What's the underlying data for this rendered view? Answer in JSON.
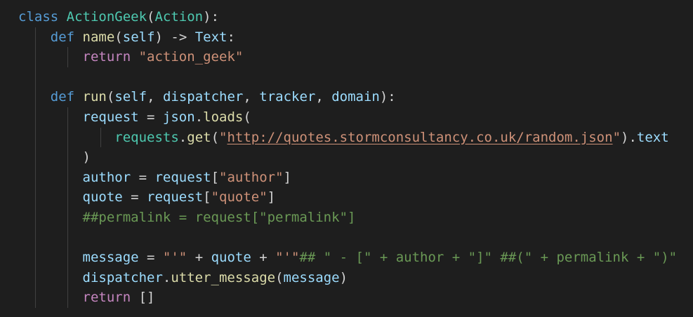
{
  "editor": {
    "colors": {
      "background": "#1e1e1e",
      "keyword": "#569cd6",
      "control": "#c586c0",
      "class": "#4ec9b0",
      "function": "#dcdcaa",
      "variable": "#9cdcfe",
      "string": "#ce9178",
      "comment": "#6a9955",
      "plain": "#d4d4d4"
    },
    "lines": [
      {
        "indent": 0,
        "tokens": [
          {
            "t": "keyword",
            "v": "class "
          },
          {
            "t": "class",
            "v": "ActionGeek"
          },
          {
            "t": "plain",
            "v": "("
          },
          {
            "t": "class",
            "v": "Action"
          },
          {
            "t": "plain",
            "v": "):"
          }
        ]
      },
      {
        "indent": 1,
        "tokens": [
          {
            "t": "keyword",
            "v": "def "
          },
          {
            "t": "function",
            "v": "name"
          },
          {
            "t": "plain",
            "v": "("
          },
          {
            "t": "param",
            "v": "self"
          },
          {
            "t": "plain",
            "v": ") -> "
          },
          {
            "t": "variable",
            "v": "Text"
          },
          {
            "t": "plain",
            "v": ":"
          }
        ]
      },
      {
        "indent": 2,
        "tokens": [
          {
            "t": "control",
            "v": "return "
          },
          {
            "t": "string",
            "v": "\"action_geek\""
          }
        ]
      },
      {
        "indent": 0,
        "tokens": []
      },
      {
        "indent": 1,
        "tokens": [
          {
            "t": "keyword",
            "v": "def "
          },
          {
            "t": "function",
            "v": "run"
          },
          {
            "t": "plain",
            "v": "("
          },
          {
            "t": "param",
            "v": "self"
          },
          {
            "t": "plain",
            "v": ", "
          },
          {
            "t": "param",
            "v": "dispatcher"
          },
          {
            "t": "plain",
            "v": ", "
          },
          {
            "t": "param",
            "v": "tracker"
          },
          {
            "t": "plain",
            "v": ", "
          },
          {
            "t": "param",
            "v": "domain"
          },
          {
            "t": "plain",
            "v": "):"
          }
        ]
      },
      {
        "indent": 2,
        "tokens": [
          {
            "t": "variable",
            "v": "request"
          },
          {
            "t": "plain",
            "v": " = "
          },
          {
            "t": "variable",
            "v": "json"
          },
          {
            "t": "plain",
            "v": "."
          },
          {
            "t": "function",
            "v": "loads"
          },
          {
            "t": "plain",
            "v": "("
          }
        ]
      },
      {
        "indent": 3,
        "tokens": [
          {
            "t": "class",
            "v": "requests"
          },
          {
            "t": "plain",
            "v": "."
          },
          {
            "t": "function",
            "v": "get"
          },
          {
            "t": "plain",
            "v": "("
          },
          {
            "t": "string",
            "v": "\""
          },
          {
            "t": "link",
            "v": "http://quotes.stormconsultancy.co.uk/random.json"
          },
          {
            "t": "string",
            "v": "\""
          },
          {
            "t": "plain",
            "v": ")."
          },
          {
            "t": "variable",
            "v": "text"
          }
        ]
      },
      {
        "indent": 2,
        "tokens": [
          {
            "t": "plain",
            "v": ")"
          }
        ]
      },
      {
        "indent": 2,
        "tokens": [
          {
            "t": "variable",
            "v": "author"
          },
          {
            "t": "plain",
            "v": " = "
          },
          {
            "t": "variable",
            "v": "request"
          },
          {
            "t": "plain",
            "v": "["
          },
          {
            "t": "string",
            "v": "\"author\""
          },
          {
            "t": "plain",
            "v": "]"
          }
        ]
      },
      {
        "indent": 2,
        "tokens": [
          {
            "t": "variable",
            "v": "quote"
          },
          {
            "t": "plain",
            "v": " = "
          },
          {
            "t": "variable",
            "v": "request"
          },
          {
            "t": "plain",
            "v": "["
          },
          {
            "t": "string",
            "v": "\"quote\""
          },
          {
            "t": "plain",
            "v": "]"
          }
        ]
      },
      {
        "indent": 2,
        "tokens": [
          {
            "t": "comment",
            "v": "##permalink = request[\"permalink\"]"
          }
        ]
      },
      {
        "indent": 0,
        "tokens": []
      },
      {
        "indent": 2,
        "tokens": [
          {
            "t": "variable",
            "v": "message"
          },
          {
            "t": "plain",
            "v": " = "
          },
          {
            "t": "string",
            "v": "\"'\""
          },
          {
            "t": "plain",
            "v": " + "
          },
          {
            "t": "variable",
            "v": "quote"
          },
          {
            "t": "plain",
            "v": " + "
          },
          {
            "t": "string",
            "v": "\"'\""
          },
          {
            "t": "comment",
            "v": "## \" - [\" + author + \"]\" ##(\" + permalink + \")\""
          }
        ]
      },
      {
        "indent": 2,
        "tokens": [
          {
            "t": "variable",
            "v": "dispatcher"
          },
          {
            "t": "plain",
            "v": "."
          },
          {
            "t": "function",
            "v": "utter_message"
          },
          {
            "t": "plain",
            "v": "("
          },
          {
            "t": "variable",
            "v": "message"
          },
          {
            "t": "plain",
            "v": ")"
          }
        ]
      },
      {
        "indent": 2,
        "tokens": [
          {
            "t": "control",
            "v": "return "
          },
          {
            "t": "plain",
            "v": "[]"
          }
        ]
      }
    ]
  }
}
